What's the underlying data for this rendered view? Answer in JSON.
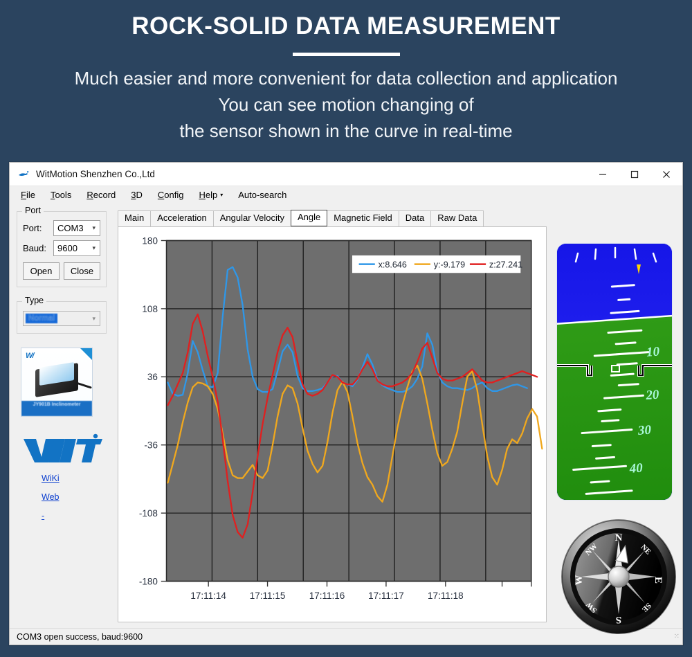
{
  "promo": {
    "title": "ROCK-SOLID DATA MEASUREMENT",
    "line1": "Much easier and more convenient for data collection and application",
    "line2": "You can see motion changing of",
    "line3": "the sensor shown in the curve in real-time"
  },
  "window": {
    "title": "WitMotion Shenzhen Co.,Ltd",
    "icon": "witmotion-logo-icon",
    "minimize": "–",
    "maximize": "☐",
    "close": "✕"
  },
  "menubar": [
    {
      "label": "File",
      "mnemonic": "F"
    },
    {
      "label": "Tools",
      "mnemonic": "T"
    },
    {
      "label": "Record",
      "mnemonic": "R"
    },
    {
      "label": "3D",
      "mnemonic": "3"
    },
    {
      "label": "Config",
      "mnemonic": "C"
    },
    {
      "label": "Help",
      "mnemonic": "H",
      "caret": "▾"
    },
    {
      "label": "Auto-search",
      "mnemonic": ""
    }
  ],
  "sidebar": {
    "port_group_title": "Port",
    "port_label": "Port:",
    "port_value": "COM3",
    "baud_label": "Baud:",
    "baud_value": "9600",
    "open_button": "Open",
    "close_button": "Close",
    "type_group_title": "Type",
    "type_value": "Normal",
    "caret": "∨",
    "product_image_caption": "JY901B Inclinometer",
    "logo_text": "WIT",
    "links": [
      {
        "label": "WiKi"
      },
      {
        "label": "Web"
      },
      {
        "label": "-"
      }
    ]
  },
  "tabs": [
    {
      "label": "Main",
      "active": false
    },
    {
      "label": "Acceleration",
      "active": false
    },
    {
      "label": "Angular Velocity",
      "active": false
    },
    {
      "label": "Angle",
      "active": true
    },
    {
      "label": "Magnetic Field",
      "active": false
    },
    {
      "label": "Data",
      "active": false
    },
    {
      "label": "Raw Data",
      "active": false
    }
  ],
  "gauges": {
    "attitude_indicator_name": "attitude-indicator",
    "attitude_pitch_labels": [
      "10",
      "20",
      "30",
      "40"
    ],
    "compass_name": "compass-gauge",
    "compass_labels": [
      "N",
      "NE",
      "E",
      "SE",
      "S",
      "SW",
      "W",
      "NW"
    ]
  },
  "statusbar": {
    "message": "COM3 open success, baud:9600",
    "grip": "⁙"
  },
  "chart_data": {
    "type": "line",
    "title": "",
    "xlabel": "",
    "ylabel": "",
    "ylim": [
      -180,
      180
    ],
    "yticks": [
      180,
      108,
      36,
      -36,
      -108,
      -180
    ],
    "xticks": [
      "17:11:14",
      "17:11:15",
      "17:11:16",
      "17:11:17",
      "17:11:18"
    ],
    "xtick_positions": [
      0.115,
      0.277,
      0.44,
      0.602,
      0.765
    ],
    "grid": true,
    "grid_color": "#1d1d1d",
    "plot_bg": "#6e6e6e",
    "legend_position": "top-right",
    "series": [
      {
        "name": "x",
        "legend": "x:8.646",
        "color": "#2f97e8",
        "values": [
          30,
          18,
          16,
          17,
          40,
          74,
          62,
          43,
          26,
          25,
          40,
          100,
          149,
          152,
          141,
          112,
          65,
          36,
          23,
          20,
          20,
          23,
          42,
          63,
          70,
          62,
          37,
          24,
          21,
          21,
          22,
          24,
          30,
          37,
          37,
          30,
          28,
          26,
          33,
          46,
          60,
          49,
          33,
          27,
          24,
          22,
          20,
          20,
          22,
          26,
          34,
          47,
          82,
          70,
          42,
          30,
          26,
          24,
          24,
          23,
          22,
          24,
          28,
          30,
          24,
          21,
          21,
          23,
          25,
          27,
          28,
          26,
          24
        ]
      },
      {
        "name": "y",
        "legend": "y:-9.179",
        "color": "#f0a81e",
        "values": [
          -76,
          -56,
          -36,
          -12,
          9,
          25,
          30,
          29,
          26,
          18,
          2,
          -24,
          -52,
          -68,
          -71,
          -71,
          -64,
          -57,
          -68,
          -71,
          -63,
          -36,
          -6,
          18,
          27,
          24,
          8,
          -18,
          -42,
          -56,
          -65,
          -58,
          -33,
          -2,
          22,
          31,
          20,
          -6,
          -34,
          -55,
          -70,
          -78,
          -90,
          -96,
          -78,
          -48,
          -18,
          6,
          25,
          42,
          48,
          34,
          8,
          -20,
          -45,
          -58,
          -54,
          -40,
          -22,
          8,
          36,
          42,
          22,
          -14,
          -48,
          -70,
          -78,
          -62,
          -40,
          -30,
          -34,
          -24,
          -8,
          2,
          -6,
          -40
        ]
      },
      {
        "name": "z",
        "legend": "z:27.241",
        "color": "#e02020",
        "values": [
          6,
          16,
          28,
          40,
          62,
          92,
          102,
          84,
          58,
          36,
          10,
          -30,
          -74,
          -110,
          -128,
          -134,
          -120,
          -86,
          -48,
          -14,
          14,
          38,
          62,
          80,
          88,
          78,
          52,
          28,
          18,
          16,
          18,
          22,
          30,
          38,
          36,
          30,
          28,
          28,
          34,
          44,
          52,
          44,
          32,
          28,
          26,
          26,
          28,
          30,
          34,
          40,
          52,
          66,
          72,
          56,
          40,
          34,
          32,
          32,
          34,
          36,
          40,
          44,
          38,
          32,
          30,
          30,
          32,
          34,
          36,
          38,
          40,
          42,
          40,
          38,
          36
        ]
      }
    ]
  }
}
